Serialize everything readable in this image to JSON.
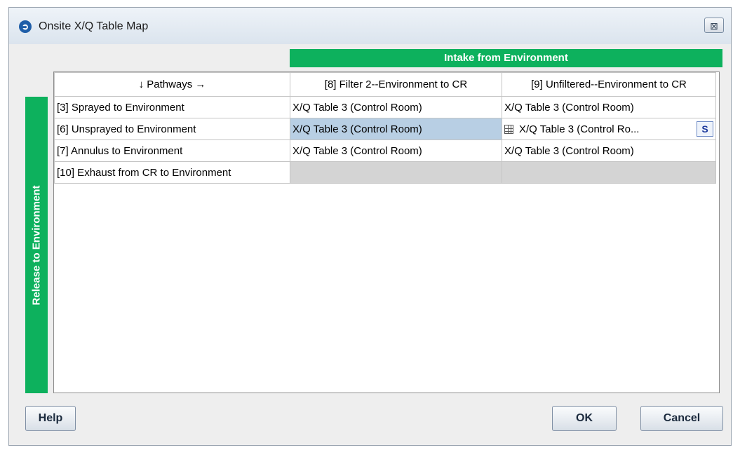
{
  "window": {
    "title": "Onsite X/Q Table  Map",
    "close_symbol": "⊠"
  },
  "banners": {
    "intake": "Intake from Environment",
    "release": "Release to Environment"
  },
  "table": {
    "corner_header": "↓ Pathways →",
    "columns": [
      "[8] Filter 2--Environment to CR",
      "[9] Unfiltered--Environment to CR"
    ],
    "rows": [
      {
        "label": "[3] Sprayed to Environment",
        "cells": [
          "X/Q Table 3 (Control Room)",
          "X/Q Table 3 (Control Room)"
        ]
      },
      {
        "label": "[6] Unsprayed to Environment",
        "cells": [
          "X/Q Table 3 (Control Room)",
          "X/Q Table 3 (Control Ro..."
        ]
      },
      {
        "label": "[7] Annulus to Environment",
        "cells": [
          "X/Q Table 3 (Control Room)",
          "X/Q Table 3 (Control Room)"
        ]
      },
      {
        "label": "[10] Exhaust from CR to Environment",
        "cells": [
          "",
          ""
        ]
      }
    ],
    "editor_button": "S"
  },
  "buttons": {
    "help": "Help",
    "ok": "OK",
    "cancel": "Cancel"
  },
  "colors": {
    "accent_green": "#0db15d",
    "selected_cell": "#b8cfe4",
    "disabled_cell": "#d4d4d4"
  }
}
